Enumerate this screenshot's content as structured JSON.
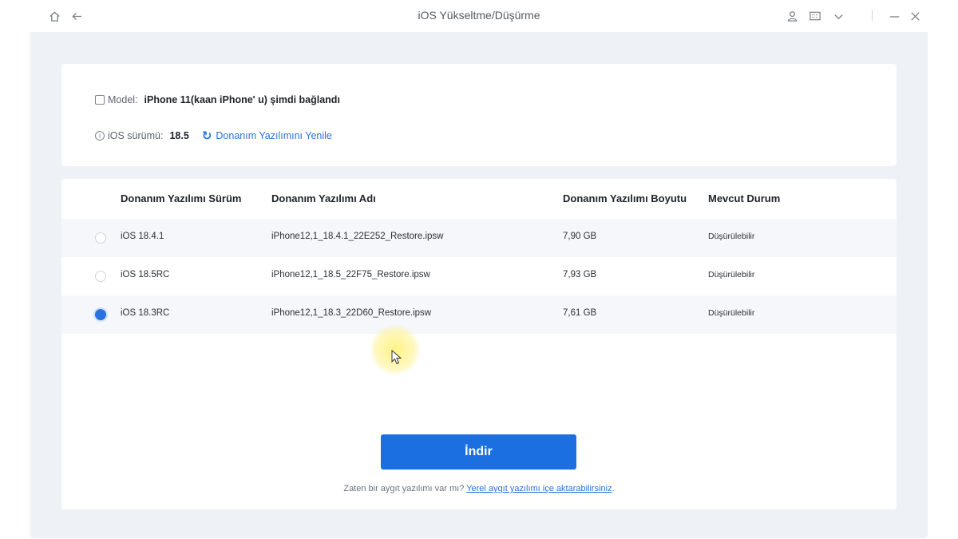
{
  "window": {
    "title": "iOS Yükseltme/Düşürme",
    "icons": [
      "home-icon",
      "back-arrow-icon",
      "user-icon",
      "message-icon",
      "chevron-down-icon",
      "minimize-icon",
      "close-icon"
    ]
  },
  "device": {
    "model_label": "Model:",
    "model_value": "iPhone 11(kaan iPhone' u) şimdi bağlandı",
    "ios_label": "iOS sürümü:",
    "ios_value": "18.5",
    "refresh_label": "Donanım Yazılımını Yenile"
  },
  "table": {
    "headers": [
      "Donanım Yazılımı Sürüm",
      "Donanım Yazılımı Adı",
      "Donanım Yazılımı Boyutu",
      "Mevcut Durum"
    ],
    "rows": [
      {
        "version": "iOS 18.4.1",
        "name": "iPhone12,1_18.4.1_22E252_Restore.ipsw",
        "size": "7,90 GB",
        "status": "Düşürülebilir",
        "selected": false
      },
      {
        "version": "iOS 18.5RC",
        "name": "iPhone12,1_18.5_22F75_Restore.ipsw",
        "size": "7,93 GB",
        "status": "Düşürülebilir",
        "selected": false
      },
      {
        "version": "iOS 18.3RC",
        "name": "iPhone12,1_18.3_22D60_Restore.ipsw",
        "size": "7,61 GB",
        "status": "Düşürülebilir",
        "selected": true
      }
    ]
  },
  "actions": {
    "download_label": "İndir",
    "note_text": "Zaten bir aygıt yazılımı var mı? ",
    "note_link": "Yerel aygıt yazılımı içe aktarabilirsiniz",
    "note_end": "."
  },
  "colors": {
    "accent": "#1c6fe0",
    "panel_bg": "#eef1f6"
  }
}
